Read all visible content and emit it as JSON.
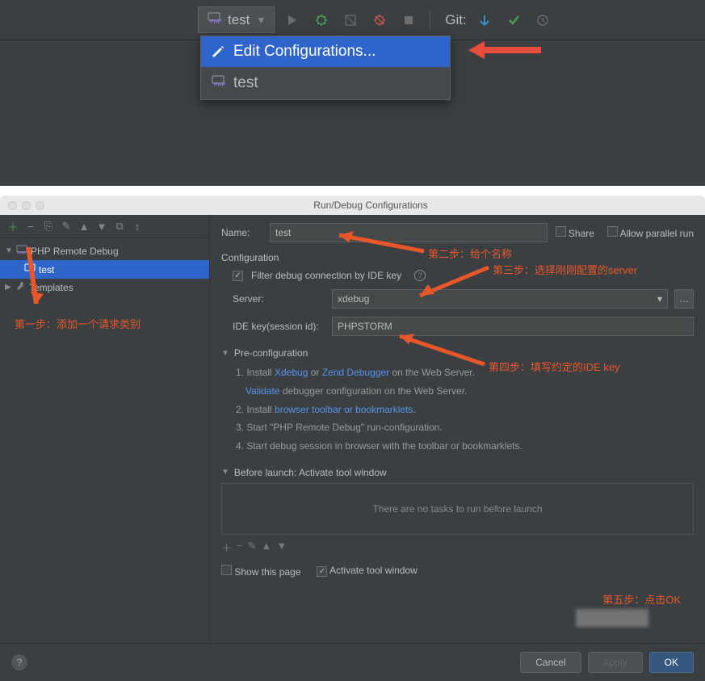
{
  "toolbar": {
    "config_name": "test",
    "git_label": "Git:"
  },
  "dropdown": {
    "edit_label": "Edit Configurations...",
    "item_label": "test"
  },
  "dialog": {
    "title": "Run/Debug Configurations",
    "sidebar": {
      "tree": {
        "root": "PHP Remote Debug",
        "child": "test",
        "templates": "Templates"
      }
    },
    "form": {
      "name_label": "Name:",
      "name_value": "test",
      "share_label": "Share",
      "allow_parallel_label": "Allow parallel run",
      "configuration_label": "Configuration",
      "filter_label": "Filter debug connection by IDE key",
      "server_label": "Server:",
      "server_value": "xdebug",
      "ide_key_label": "IDE key(session id):",
      "ide_key_value": "PHPSTORM"
    },
    "preconfig": {
      "header": "Pre-configuration",
      "step1_prefix": "1. Install ",
      "step1_link1": "Xdebug",
      "step1_or": " or ",
      "step1_link2": "Zend Debugger",
      "step1_suffix": " on the Web Server.",
      "step1b_link": "Validate",
      "step1b_suffix": " debugger configuration on the Web Server.",
      "step2_prefix": "2. Install ",
      "step2_link": "browser toolbar or bookmarklets",
      "step2_suffix": ".",
      "step3": "3. Start \"PHP Remote Debug\" run-configuration.",
      "step4": "4. Start debug session in browser with the toolbar or bookmarklets."
    },
    "before_launch": {
      "header": "Before launch: Activate tool window",
      "empty_text": "There are no tasks to run before launch",
      "show_page": "Show this page",
      "activate_window": "Activate tool window"
    },
    "footer": {
      "cancel": "Cancel",
      "apply": "Apply",
      "ok": "OK"
    }
  },
  "annotations": {
    "step1": "第一步：添加一个请求类别",
    "step2": "第二步：给个名称",
    "step3": "第三步：选择刚刚配置的server",
    "step4": "第四步：填写约定的IDE key",
    "step5": "第五步：点击OK"
  }
}
